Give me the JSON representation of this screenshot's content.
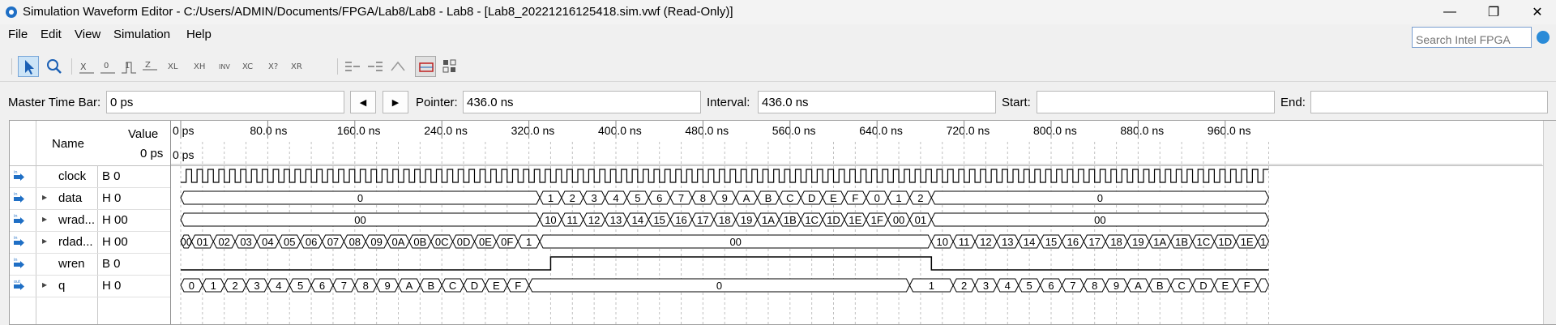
{
  "window": {
    "title": "Simulation Waveform Editor - C:/Users/ADMIN/Documents/FPGA/Lab8/Lab8 - Lab8 - [Lab8_20221216125418.sim.vwf (Read-Only)]",
    "minimize": "—",
    "restore": "❐",
    "close": "✕"
  },
  "menu": {
    "items": [
      "File",
      "Edit",
      "View",
      "Simulation",
      "Help"
    ]
  },
  "search": {
    "placeholder": "Search Intel FPGA"
  },
  "toolbar": {
    "tools": [
      "pointer-tool-icon",
      "zoom-tool-icon",
      "unknown-value-icon",
      "force-low-icon",
      "force-high-icon",
      "high-impedance-icon",
      "weak-low-icon",
      "weak-high-icon",
      "invert-icon",
      "count-value-icon",
      "random-value-icon",
      "arbitrary-value-icon",
      "group-icon",
      "ungroup-icon",
      "sort-icon",
      "snap-to-grid-icon",
      "grid-settings-icon"
    ]
  },
  "fields": {
    "master_time_bar_label": "Master Time Bar:",
    "master_time_bar_value": "0 ps",
    "prev_label": "◀",
    "next_label": "▶",
    "pointer_label": "Pointer:",
    "pointer_value": "436.0 ns",
    "interval_label": "Interval:",
    "interval_value": "436.0 ns",
    "start_label": "Start:",
    "start_value": "",
    "end_label": "End:",
    "end_value": ""
  },
  "columns": {
    "name": "Name",
    "value": "Value",
    "value_time": "0 ps",
    "timeline_start": "0 ps"
  },
  "timeline": {
    "ticks": [
      "0 ps",
      "80.0 ns",
      "160.0 ns",
      "240.0 ns",
      "320.0 ns",
      "400.0 ns",
      "480.0 ns",
      "560.0 ns",
      "640.0 ns",
      "720.0 ns",
      "800.0 ns",
      "880.0 ns",
      "960.0 ns"
    ],
    "marker": "0 ps"
  },
  "signals": [
    {
      "name": "clock",
      "value": "B 0",
      "icon": "input-pin-icon",
      "expandable": false,
      "type": "clock"
    },
    {
      "name": "data",
      "value": "H 0",
      "icon": "input-bus-icon",
      "expandable": true,
      "type": "bus",
      "segments": [
        [
          "0",
          0,
          330
        ],
        [
          "1",
          330,
          350
        ],
        [
          "2",
          350,
          370
        ],
        [
          "3",
          370,
          390
        ],
        [
          "4",
          390,
          410
        ],
        [
          "5",
          410,
          430
        ],
        [
          "6",
          430,
          450
        ],
        [
          "7",
          450,
          470
        ],
        [
          "8",
          470,
          490
        ],
        [
          "9",
          490,
          510
        ],
        [
          "A",
          510,
          530
        ],
        [
          "B",
          530,
          550
        ],
        [
          "C",
          550,
          570
        ],
        [
          "D",
          570,
          590
        ],
        [
          "E",
          590,
          610
        ],
        [
          "F",
          610,
          630
        ],
        [
          "0",
          630,
          650
        ],
        [
          "1",
          650,
          670
        ],
        [
          "2",
          670,
          690
        ],
        [
          "0",
          690,
          1000
        ]
      ]
    },
    {
      "name": "wrad...",
      "value": "H 00",
      "icon": "input-bus-icon",
      "expandable": true,
      "type": "bus",
      "segments": [
        [
          "00",
          0,
          330
        ],
        [
          "10",
          330,
          350
        ],
        [
          "11",
          350,
          370
        ],
        [
          "12",
          370,
          390
        ],
        [
          "13",
          390,
          410
        ],
        [
          "14",
          410,
          430
        ],
        [
          "15",
          430,
          450
        ],
        [
          "16",
          450,
          470
        ],
        [
          "17",
          470,
          490
        ],
        [
          "18",
          490,
          510
        ],
        [
          "19",
          510,
          530
        ],
        [
          "1A",
          530,
          550
        ],
        [
          "1B",
          550,
          570
        ],
        [
          "1C",
          570,
          590
        ],
        [
          "1D",
          590,
          610
        ],
        [
          "1E",
          610,
          630
        ],
        [
          "1F",
          630,
          650
        ],
        [
          "00",
          650,
          670
        ],
        [
          "01",
          670,
          690
        ],
        [
          "00",
          690,
          1000
        ]
      ]
    },
    {
      "name": "rdad...",
      "value": "H 00",
      "icon": "input-bus-icon",
      "expandable": true,
      "type": "bus",
      "segments": [
        [
          "00",
          0,
          10
        ],
        [
          "01",
          10,
          30
        ],
        [
          "02",
          30,
          50
        ],
        [
          "03",
          50,
          70
        ],
        [
          "04",
          70,
          90
        ],
        [
          "05",
          90,
          110
        ],
        [
          "06",
          110,
          130
        ],
        [
          "07",
          130,
          150
        ],
        [
          "08",
          150,
          170
        ],
        [
          "09",
          170,
          190
        ],
        [
          "0A",
          190,
          210
        ],
        [
          "0B",
          210,
          230
        ],
        [
          "0C",
          230,
          250
        ],
        [
          "0D",
          250,
          270
        ],
        [
          "0E",
          270,
          290
        ],
        [
          "0F",
          290,
          310
        ],
        [
          "1",
          310,
          330
        ],
        [
          "00",
          330,
          690
        ],
        [
          "10",
          690,
          710
        ],
        [
          "11",
          710,
          730
        ],
        [
          "12",
          730,
          750
        ],
        [
          "13",
          750,
          770
        ],
        [
          "14",
          770,
          790
        ],
        [
          "15",
          790,
          810
        ],
        [
          "16",
          810,
          830
        ],
        [
          "17",
          830,
          850
        ],
        [
          "18",
          850,
          870
        ],
        [
          "19",
          870,
          890
        ],
        [
          "1A",
          890,
          910
        ],
        [
          "1B",
          910,
          930
        ],
        [
          "1C",
          930,
          950
        ],
        [
          "1D",
          950,
          970
        ],
        [
          "1E",
          970,
          990
        ],
        [
          "1",
          990,
          1000
        ]
      ]
    },
    {
      "name": "wren",
      "value": "B 0",
      "icon": "input-pin-icon",
      "expandable": false,
      "type": "bit",
      "high_from": 340,
      "high_to": 690
    },
    {
      "name": "q",
      "value": "H 0",
      "icon": "output-bus-icon",
      "expandable": true,
      "type": "bus",
      "segments": [
        [
          "0",
          0,
          20
        ],
        [
          "1",
          20,
          40
        ],
        [
          "2",
          40,
          60
        ],
        [
          "3",
          60,
          80
        ],
        [
          "4",
          80,
          100
        ],
        [
          "5",
          100,
          120
        ],
        [
          "6",
          120,
          140
        ],
        [
          "7",
          140,
          160
        ],
        [
          "8",
          160,
          180
        ],
        [
          "9",
          180,
          200
        ],
        [
          "A",
          200,
          220
        ],
        [
          "B",
          220,
          240
        ],
        [
          "C",
          240,
          260
        ],
        [
          "D",
          260,
          280
        ],
        [
          "E",
          280,
          300
        ],
        [
          "F",
          300,
          320
        ],
        [
          "0",
          320,
          670
        ],
        [
          "1",
          670,
          710
        ],
        [
          "2",
          710,
          730
        ],
        [
          "3",
          730,
          750
        ],
        [
          "4",
          750,
          770
        ],
        [
          "5",
          770,
          790
        ],
        [
          "6",
          790,
          810
        ],
        [
          "7",
          810,
          830
        ],
        [
          "8",
          830,
          850
        ],
        [
          "9",
          850,
          870
        ],
        [
          "A",
          870,
          890
        ],
        [
          "B",
          890,
          910
        ],
        [
          "C",
          910,
          930
        ],
        [
          "D",
          930,
          950
        ],
        [
          "E",
          950,
          970
        ],
        [
          "F",
          970,
          990
        ],
        [
          "",
          990,
          1000
        ]
      ]
    }
  ],
  "colors": {
    "waveform": "#000000",
    "gridline": "#c0c0c0",
    "selected": "#cce4f7",
    "accent": "#2a8bd8"
  }
}
